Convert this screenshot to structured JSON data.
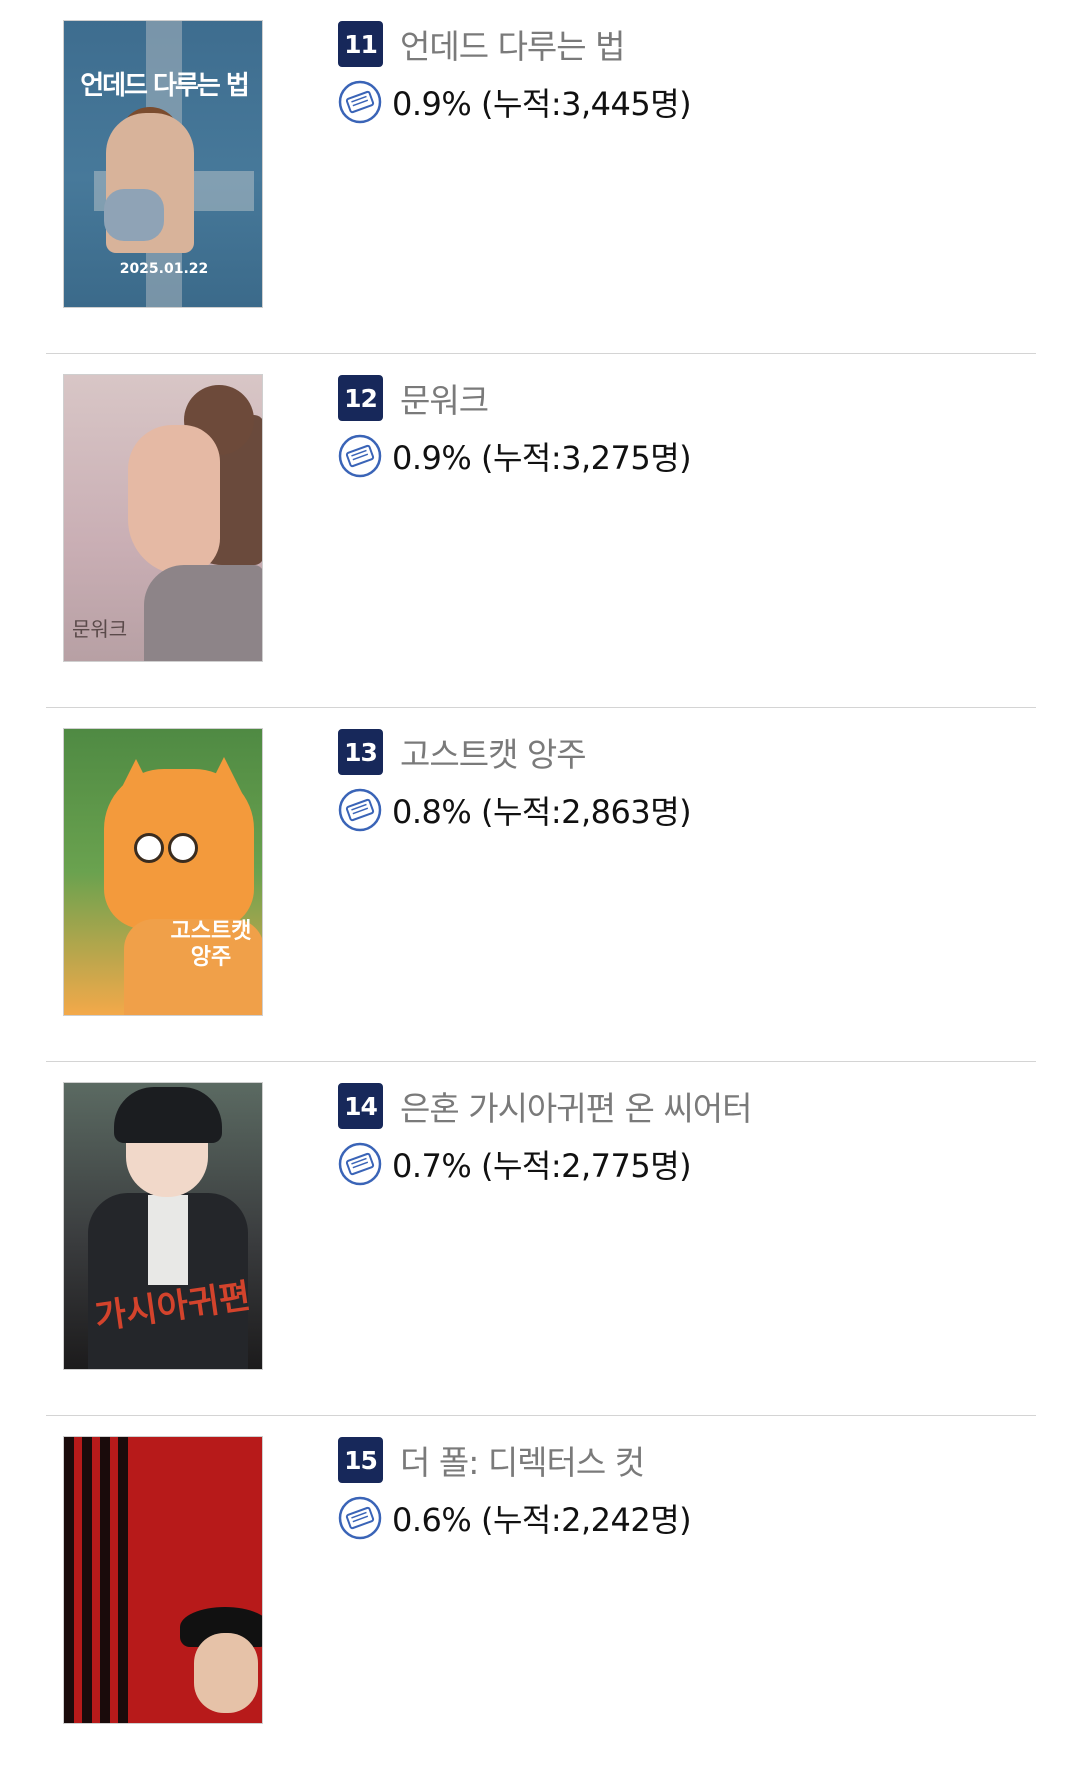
{
  "items": [
    {
      "rank": "11",
      "title": "언데드 다루는 법",
      "stat": "0.9% (누적:3,445명)",
      "poster_title": "언데드 다루는 법",
      "poster_date": "2025.01.22"
    },
    {
      "rank": "12",
      "title": "문워크",
      "stat": "0.9% (누적:3,275명)",
      "poster_title": "문워크"
    },
    {
      "rank": "13",
      "title": "고스트캣 앙주",
      "stat": "0.8% (누적:2,863명)",
      "poster_title": "고스트캣 앙주"
    },
    {
      "rank": "14",
      "title": "은혼 가시아귀편 온 씨어터",
      "stat": "0.7% (누적:2,775명)",
      "poster_title": "가시아귀편"
    },
    {
      "rank": "15",
      "title": "더 폴: 디렉터스 컷",
      "stat": "0.6% (누적:2,242명)",
      "poster_title": ""
    }
  ],
  "icons": {
    "ticket": "ticket-icon"
  },
  "colors": {
    "rank_bg": "#17285a",
    "title": "#7a7a7a",
    "icon": "#3a64b7"
  }
}
